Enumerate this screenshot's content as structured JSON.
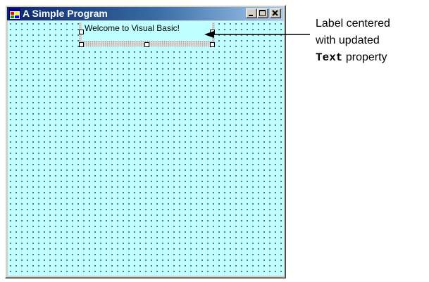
{
  "window": {
    "title": "A Simple Program",
    "icon": "form-app-icon",
    "controls": {
      "minimize_icon": "minimize-icon",
      "maximize_icon": "maximize-icon",
      "close_icon": "close-icon"
    }
  },
  "form": {
    "background_color": "#c0ffff",
    "grid_dot_color": "#000000",
    "label": {
      "text": "Welcome to Visual Basic!",
      "selected": true
    }
  },
  "callout": {
    "line1": "Label centered",
    "line2": "with updated",
    "line3_code": "Text",
    "line3_rest": "property"
  }
}
